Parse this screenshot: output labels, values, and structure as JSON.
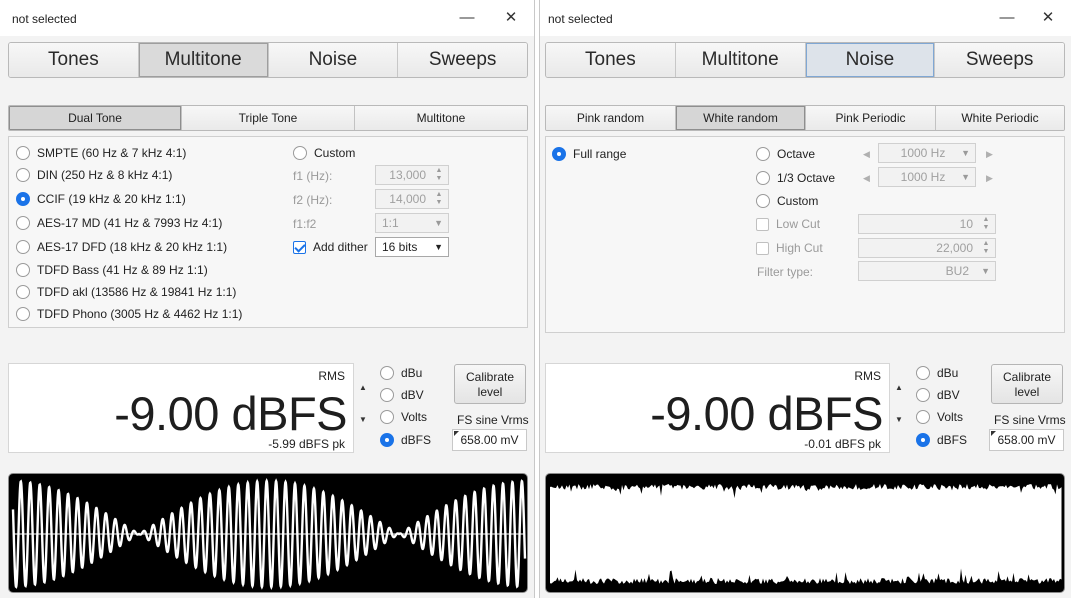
{
  "left": {
    "title": "not selected",
    "window_controls": {
      "minimize": "—",
      "close": "✕"
    },
    "main_tabs": [
      "Tones",
      "Multitone",
      "Noise",
      "Sweeps"
    ],
    "sub_tabs": [
      "Dual Tone",
      "Triple Tone",
      "Multitone"
    ],
    "presets": [
      "SMPTE (60 Hz & 7 kHz 4:1)",
      "DIN (250 Hz & 8 kHz 4:1)",
      "CCIF (19 kHz & 20 kHz 1:1)",
      "AES-17 MD (41 Hz & 7993 Hz 4:1)",
      "AES-17 DFD (18 kHz & 20 kHz 1:1)",
      "TDFD Bass (41 Hz & 89 Hz 1:1)",
      "TDFD akl (13586 Hz & 19841 Hz 1:1)",
      "TDFD Phono (3005 Hz & 4462 Hz 1:1)"
    ],
    "custom": {
      "label": "Custom",
      "f1_label": "f1 (Hz):",
      "f1_value": "13,000",
      "f2_label": "f2 (Hz):",
      "f2_value": "14,000",
      "ratio_label": "f1:f2",
      "ratio_value": "1:1",
      "dither_label": "Add dither",
      "dither_value": "16 bits"
    },
    "level": {
      "rms_label": "RMS",
      "value": "-9.00 dBFS",
      "peak": "-5.99 dBFS pk"
    },
    "units": [
      "dBu",
      "dBV",
      "Volts",
      "dBFS"
    ],
    "calibrate_label": "Calibrate\nlevel",
    "fs_label": "FS sine Vrms",
    "fs_value": "658.00 mV"
  },
  "right": {
    "title": "not selected",
    "window_controls": {
      "minimize": "—",
      "close": "✕"
    },
    "main_tabs": [
      "Tones",
      "Multitone",
      "Noise",
      "Sweeps"
    ],
    "sub_tabs": [
      "Pink random",
      "White random",
      "Pink Periodic",
      "White Periodic"
    ],
    "full_range_label": "Full range",
    "octave_label": "Octave",
    "octave_value": "1000 Hz",
    "third_octave_label": "1/3 Octave",
    "third_octave_value": "1000 Hz",
    "custom_label": "Custom",
    "low_cut_label": "Low Cut",
    "low_cut_value": "10",
    "high_cut_label": "High Cut",
    "high_cut_value": "22,000",
    "filter_type_label": "Filter type:",
    "filter_type_value": "BU2",
    "level": {
      "rms_label": "RMS",
      "value": "-9.00 dBFS",
      "peak": "-0.01 dBFS pk"
    },
    "units": [
      "dBu",
      "dBV",
      "Volts",
      "dBFS"
    ],
    "calibrate_label": "Calibrate\nlevel",
    "fs_label": "FS sine Vrms",
    "fs_value": "658.00 mV"
  },
  "colors": {
    "accent": "#1a73e8",
    "scope_bg": "#000000",
    "trace": "#ffffff"
  }
}
